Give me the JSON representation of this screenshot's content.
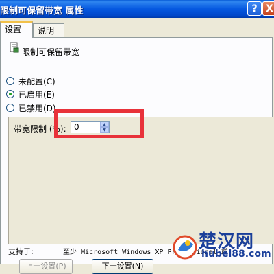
{
  "window": {
    "title": "限制可保留带宽 属性",
    "help_glyph": "?",
    "close_glyph": "X"
  },
  "tabs": [
    {
      "label": "设置",
      "active": true
    },
    {
      "label": "说明",
      "active": false
    }
  ],
  "policy": {
    "icon": "policy-setting-icon",
    "name": "限制可保留带宽"
  },
  "options": [
    {
      "label": "未配置(C)",
      "checked": false
    },
    {
      "label": "已启用(E)",
      "checked": true
    },
    {
      "label": "已禁用(D)",
      "checked": false
    }
  ],
  "bandwidth": {
    "label": "带宽限制 (%):",
    "value": "0"
  },
  "support": {
    "label": "支持于:",
    "value": "至少 Microsoft Windows XP Professional 或"
  },
  "buttons": {
    "prev": "上一设置(P)",
    "next": "下一设置(N)"
  },
  "watermark": {
    "name": "楚汉网",
    "url": "hubei88.com"
  },
  "colors": {
    "highlight_box": "#e8323a",
    "titlebar": "#0558e0"
  }
}
